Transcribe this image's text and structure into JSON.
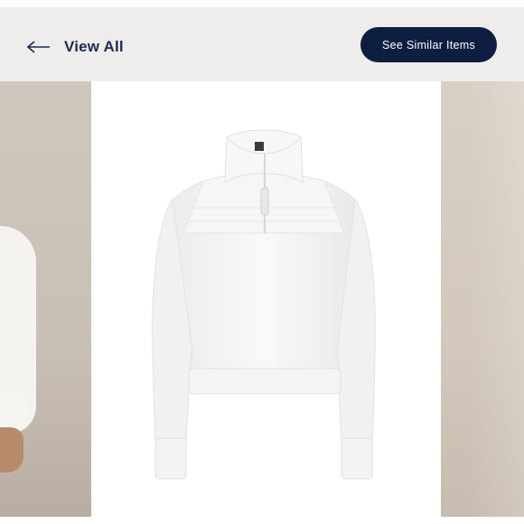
{
  "header": {
    "back_label": "View All",
    "similar_button_label": "See Similar Items"
  },
  "icons": {
    "back": "arrow-left-icon"
  },
  "carousel": {
    "items": [
      {
        "description_icon": "model-in-white-pullover-photo"
      },
      {
        "description_icon": "white-quarter-zip-pullover-photo"
      },
      {
        "description_icon": "beige-backdrop-photo"
      }
    ]
  },
  "colors": {
    "button_bg": "#0d1e40",
    "link_text": "#1b2a4e",
    "panel_bg": "#efedeb"
  }
}
